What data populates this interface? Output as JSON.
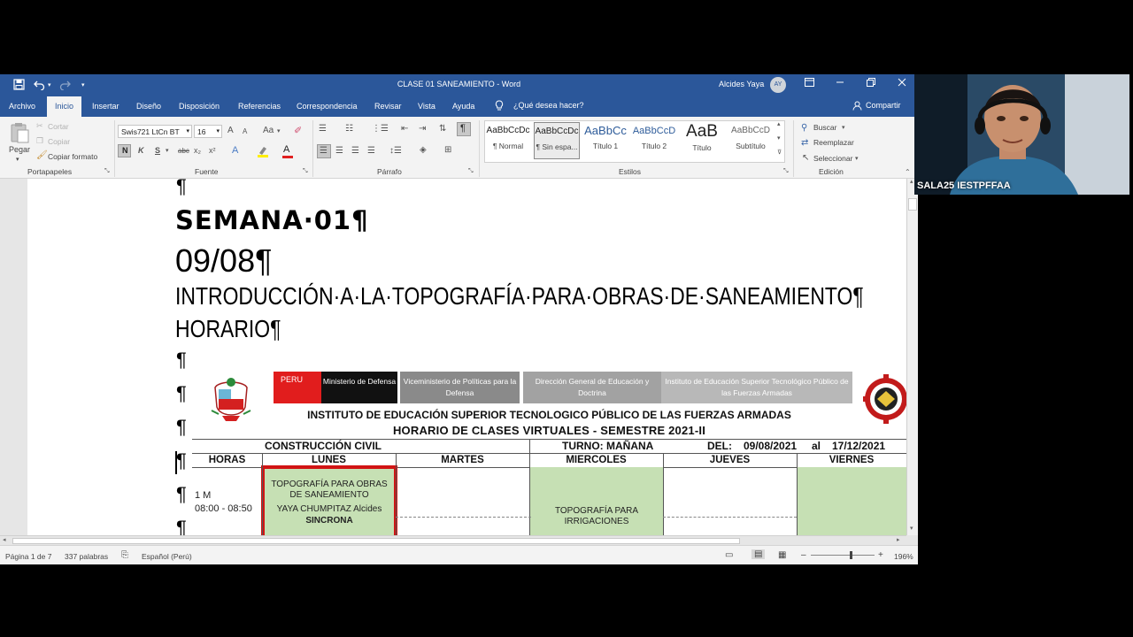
{
  "window": {
    "title": "CLASE 01 SANEAMIENTO  -  Word",
    "user_name": "Alcides Yaya",
    "user_initials": "AY",
    "qat_more": "▾"
  },
  "tabs": [
    "Archivo",
    "Inicio",
    "Insertar",
    "Diseño",
    "Disposición",
    "Referencias",
    "Correspondencia",
    "Revisar",
    "Vista",
    "Ayuda"
  ],
  "tell_me": "¿Qué desea hacer?",
  "share": "Compartir",
  "ribbon": {
    "clipboard": {
      "paste": "Pegar",
      "cut": "Cortar",
      "copy": "Copiar",
      "format_painter": "Copiar formato",
      "label": "Portapapeles"
    },
    "font": {
      "name": "Swis721 LtCn BT",
      "size": "16",
      "label": "Fuente",
      "bold": "N",
      "italic": "K",
      "underline": "S",
      "strike": "abc",
      "sub": "x₂",
      "sup": "x²",
      "aa": "Aa",
      "grow": "A",
      "shrink": "A",
      "color_a": "A"
    },
    "paragraph": {
      "label": "Párrafo"
    },
    "styles": {
      "label": "Estilos",
      "items": [
        {
          "sample": "AaBbCcDc",
          "name": "¶ Normal"
        },
        {
          "sample": "AaBbCcDc",
          "name": "¶ Sin espa..."
        },
        {
          "sample": "AaBbCc",
          "name": "Título 1"
        },
        {
          "sample": "AaBbCcD",
          "name": "Título 2"
        },
        {
          "sample": "AaB",
          "name": "Título"
        },
        {
          "sample": "AaBbCcD",
          "name": "Subtítulo"
        }
      ]
    },
    "editing": {
      "find": "Buscar",
      "replace": "Reemplazar",
      "select": "Seleccionar",
      "label": "Edición"
    }
  },
  "document": {
    "pilcrow": "¶",
    "week": "SEMANA·01¶",
    "date": "09/08¶",
    "course": "INTRODUCCIÓN·A·LA·TOPOGRAFÍA·PARA·OBRAS·DE·SANEAMIENTO¶",
    "schedule_heading": "HORARIO¶"
  },
  "schedule_image": {
    "peru": "PERU",
    "ministry": "Ministerio de Defensa",
    "vice": "Viceministerio de Políticas para la Defensa",
    "dgeneral": "Dirección General de Educación y Doctrina",
    "institute_box": "Instituto de Educación Superior Tecnológico Público de las Fuerzas Armadas",
    "institute": "INSTITUTO DE EDUCACIÓN SUPERIOR TECNOLOGICO PÚBLICO DE LAS FUERZAS ARMADAS",
    "title": "HORARIO DE CLASES VIRTUALES - SEMESTRE  2021-II",
    "career": "CONSTRUCCIÓN CIVIL",
    "shift": "TURNO:  MAÑANA",
    "from_label": "DEL:",
    "from": "09/08/2021",
    "to_label": "al",
    "to": "17/12/2021",
    "headers": [
      "HORAS",
      "LUNES",
      "MARTES",
      "MIERCOLES",
      "JUEVES",
      "VIERNES"
    ],
    "slot_label": "1 M",
    "slot_time": "08:00 - 08:50",
    "monday_course": "TOPOGRAFÍA PARA OBRAS DE SANEAMIENTO",
    "monday_teacher": "YAYA CHUMPITAZ Alcides",
    "monday_mode": "SINCRONA",
    "wednesday_course": "TOPOGRAFÍA PARA IRRIGACIONES",
    "cog_text": "CONSTRUCCIÓN"
  },
  "status": {
    "page": "Página 1 de 7",
    "words": "337 palabras",
    "language": "Español (Perú)",
    "zoom": "196%",
    "zoom_level_percent": 196
  },
  "webcam": {
    "name": "SALA25 IESTPFFAA"
  },
  "colors": {
    "word_blue": "#2b579a",
    "peru_red": "#e11d1d",
    "ministry_black": "#111111",
    "bar_gray": "#8a8a8a",
    "cell_green": "#c6e0b4",
    "highlight_red": "#d11414"
  }
}
